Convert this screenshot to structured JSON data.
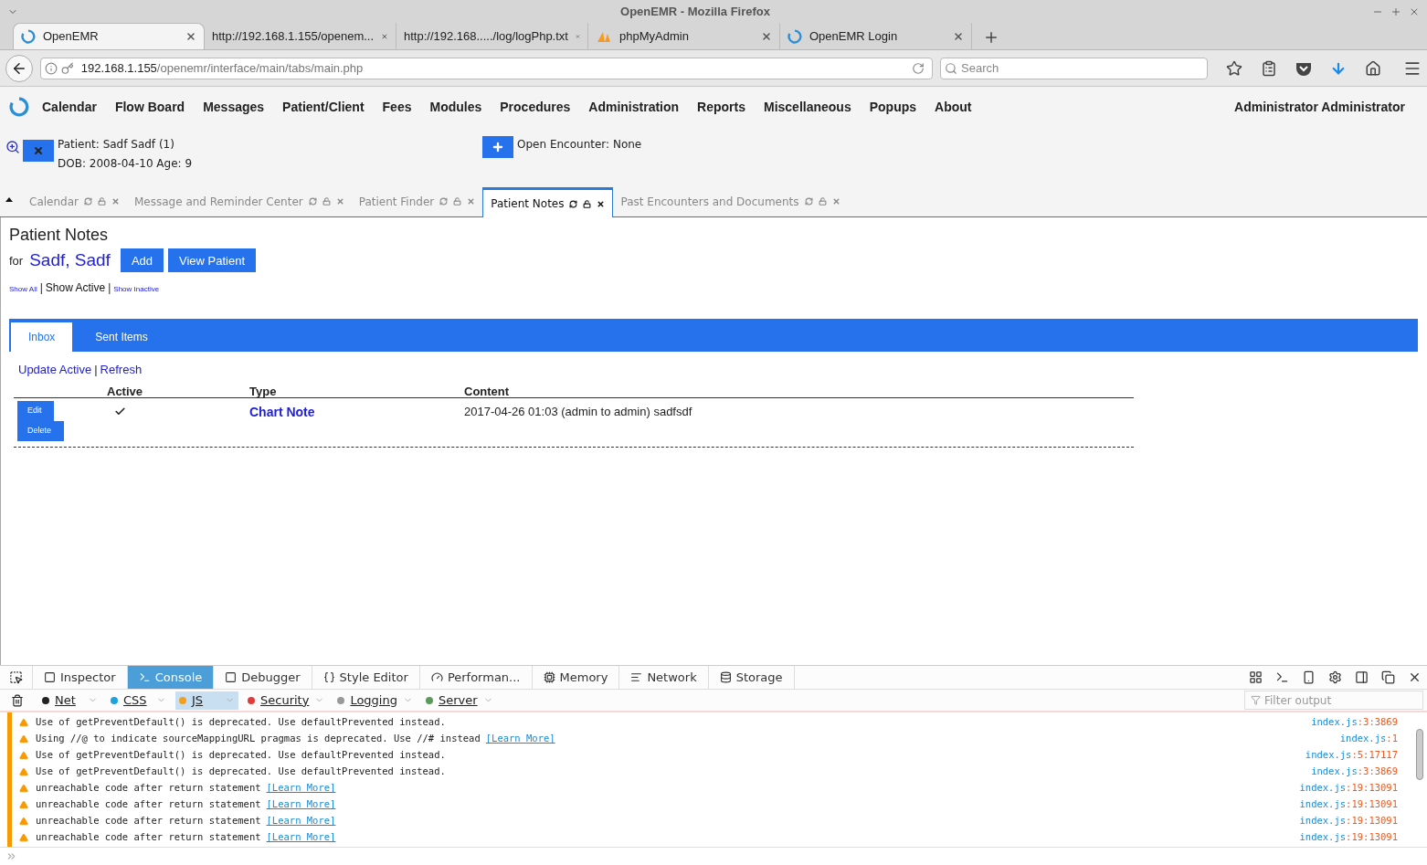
{
  "window": {
    "title": "OpenEMR - Mozilla Firefox"
  },
  "browser_tabs": [
    {
      "label": "OpenEMR",
      "selected": true,
      "kind": "logo"
    },
    {
      "label": "http://192.168.1.155/openem...",
      "selected": false,
      "kind": "plain"
    },
    {
      "label": "http://192.168...../log/logPhp.txt",
      "selected": false,
      "kind": "plain"
    },
    {
      "label": "phpMyAdmin",
      "selected": false,
      "kind": "pma"
    },
    {
      "label": "OpenEMR Login",
      "selected": false,
      "kind": "logo"
    }
  ],
  "address_bar": {
    "host": "192.168.1.155",
    "path": "/openemr/interface/main/tabs/main.php"
  },
  "search": {
    "placeholder": "Search"
  },
  "menu": [
    "Calendar",
    "Flow Board",
    "Messages",
    "Patient/Client",
    "Fees",
    "Modules",
    "Procedures",
    "Administration",
    "Reports",
    "Miscellaneous",
    "Popups",
    "About"
  ],
  "user": "Administrator Administrator",
  "patient": {
    "name": "Patient: Sadf Sadf (1)",
    "dob": "DOB: 2008-04-10 Age: 9"
  },
  "encounter": "Open Encounter: None",
  "app_tabs": [
    {
      "label": "Calendar",
      "selected": false
    },
    {
      "label": "Message and Reminder Center",
      "selected": false
    },
    {
      "label": "Patient Finder",
      "selected": false
    },
    {
      "label": "Patient Notes",
      "selected": true
    },
    {
      "label": "Past Encounters and Documents",
      "selected": false
    }
  ],
  "page": {
    "title": "Patient Notes",
    "for_label": "for",
    "patient_name": "Sadf, Sadf",
    "buttons": [
      "Add",
      "View Patient"
    ],
    "filters": [
      {
        "kind": "link",
        "label": "Show All",
        "selected": false
      },
      {
        "kind": "separator",
        "label": "|"
      },
      {
        "kind": "link",
        "label": "Show Active",
        "selected": true
      },
      {
        "kind": "separator",
        "label": "|"
      },
      {
        "kind": "link",
        "label": "Show Inactive",
        "selected": false
      }
    ],
    "note_tabs": [
      {
        "label": "Inbox",
        "selected": true
      },
      {
        "label": "Sent Items",
        "selected": false
      }
    ],
    "actions": [
      {
        "kind": "link",
        "label": "Update Active"
      },
      {
        "kind": "separator",
        "label": "|"
      },
      {
        "kind": "link",
        "label": "Refresh"
      }
    ],
    "table": {
      "columns": [
        "Active",
        "Type",
        "Content"
      ],
      "rows": [
        {
          "buttons": [
            "Edit",
            "Delete"
          ],
          "active": true,
          "type": "Chart Note",
          "content": "2017-04-26 01:03 (admin to admin) sadfsdf"
        }
      ]
    }
  },
  "devtools": {
    "tabs": [
      {
        "label": "Inspector",
        "selected": false
      },
      {
        "label": "Console",
        "selected": true
      },
      {
        "label": "Debugger",
        "selected": false
      },
      {
        "label": "Style Editor",
        "selected": false
      },
      {
        "label": "Performan...",
        "selected": false
      },
      {
        "label": "Memory",
        "selected": false
      },
      {
        "label": "Network",
        "selected": false
      },
      {
        "label": "Storage",
        "selected": false
      }
    ],
    "filters": [
      {
        "label": "Net",
        "color": "#222222",
        "selected": false
      },
      {
        "label": "CSS",
        "color": "#1ea1e0",
        "selected": false
      },
      {
        "label": "JS",
        "color": "#f0a020",
        "selected": true
      },
      {
        "label": "Security",
        "color": "#e03c3c",
        "selected": false
      },
      {
        "label": "Logging",
        "color": "#999999",
        "selected": false
      },
      {
        "label": "Server",
        "color": "#5a9a5a",
        "selected": false
      }
    ],
    "filter_placeholder": "Filter output",
    "messages": [
      {
        "text": "Use of getPreventDefault() is deprecated. Use defaultPrevented instead.",
        "file": "index.js",
        "loc": ":3:3869"
      },
      {
        "text": "Using //@ to indicate sourceMappingURL pragmas is deprecated. Use //# instead",
        "link": "[Learn More]",
        "file": "index.js",
        "loc": ":1"
      },
      {
        "text": "Use of getPreventDefault() is deprecated. Use defaultPrevented instead.",
        "file": "index.js",
        "loc": ":5:17117"
      },
      {
        "text": "Use of getPreventDefault() is deprecated. Use defaultPrevented instead.",
        "file": "index.js",
        "loc": ":3:3869"
      },
      {
        "text": "unreachable code after return statement",
        "link": "[Learn More]",
        "file": "index.js",
        "loc": ":19:13091"
      },
      {
        "text": "unreachable code after return statement",
        "link": "[Learn More]",
        "file": "index.js",
        "loc": ":19:13091"
      },
      {
        "text": "unreachable code after return statement",
        "link": "[Learn More]",
        "file": "index.js",
        "loc": ":19:13091"
      },
      {
        "text": "unreachable code after return statement",
        "link": "[Learn More]",
        "file": "index.js",
        "loc": ":19:13091"
      }
    ]
  }
}
